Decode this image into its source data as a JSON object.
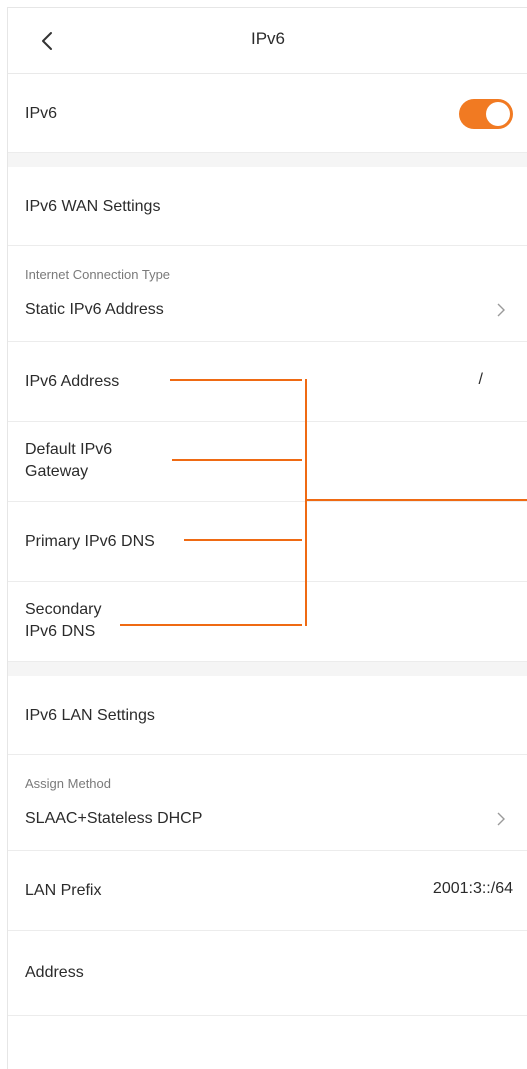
{
  "header": {
    "title": "IPv6",
    "back_icon": "chevron-left-icon"
  },
  "ipv6_toggle": {
    "label": "IPv6",
    "state": "on",
    "color": "#f17a22"
  },
  "wan": {
    "section_title": "IPv6 WAN Settings",
    "connection_type": {
      "label": "Internet Connection Type",
      "value": "Static IPv6 Address",
      "icon": "chevron-right-icon"
    },
    "fields": [
      {
        "label": "IPv6 Address",
        "value": "/"
      },
      {
        "label": "Default IPv6\nGateway",
        "value": ""
      },
      {
        "label": "Primary IPv6 DNS",
        "value": ""
      },
      {
        "label": "Secondary\nIPv6 DNS",
        "value": ""
      }
    ]
  },
  "lan": {
    "section_title": "IPv6 LAN Settings",
    "assign_method": {
      "label": "Assign Method",
      "value": "SLAAC+Stateless DHCP",
      "icon": "chevron-right-icon"
    },
    "lan_prefix": {
      "label": "LAN Prefix",
      "value": "2001:3::/64"
    },
    "address": {
      "label": "Address",
      "value": ""
    }
  },
  "annotation_color": "#ef6a13"
}
